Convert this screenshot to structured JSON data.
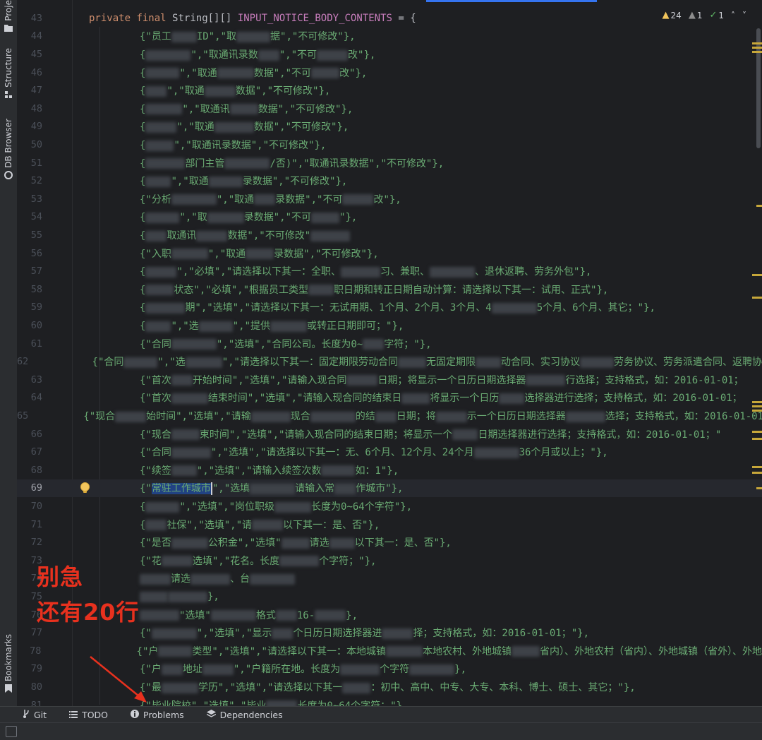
{
  "left_toolbar": {
    "tabs": [
      {
        "label": "Proje",
        "icon": "folder-icon"
      },
      {
        "label": "Structure",
        "icon": "structure-icon"
      },
      {
        "label": "DB Browser",
        "icon": "database-icon"
      },
      {
        "label": "Bookmarks",
        "icon": "bookmark-icon"
      }
    ]
  },
  "inspections": {
    "warnings": "24",
    "weak_warnings": "1",
    "typos": "1",
    "up_arrow": "˄",
    "down_arrow": "˅"
  },
  "editor": {
    "current_line": "69",
    "lines": [
      {
        "n": "43",
        "declaration": {
          "kw1": "private",
          "kw2": "final",
          "type": "String[][]",
          "name": "INPUT_NOTICE_BODY_CONTENTS",
          "rest": " = {"
        }
      },
      {
        "n": "44",
        "parts": [
          "{\"员工",
          "█",
          "ID\",\"取",
          "█",
          "据\",\"不可修改\"},"
        ]
      },
      {
        "n": "45",
        "parts": [
          "{",
          "█",
          "\",\"取通讯录数",
          "█",
          "\",\"不可",
          "█",
          "改\"},"
        ]
      },
      {
        "n": "46",
        "parts": [
          "{",
          "█",
          "\",\"取通",
          "█",
          "数据\",\"不可",
          "█",
          "改\"},"
        ]
      },
      {
        "n": "47",
        "parts": [
          "{",
          "█",
          "\",\"取通",
          "█",
          "数据\",\"不可修改\"},"
        ]
      },
      {
        "n": "48",
        "parts": [
          "{",
          "█",
          "\",\"取通讯",
          "█",
          "数据\",\"不可修改\"},"
        ]
      },
      {
        "n": "49",
        "parts": [
          "{",
          "█",
          "\",\"取通",
          "█",
          "数据\",\"不可修改\"},"
        ]
      },
      {
        "n": "50",
        "parts": [
          "{",
          "█",
          "\",\"取通讯录数据\",\"不可修改\"},"
        ]
      },
      {
        "n": "51",
        "parts": [
          "{",
          "█",
          "部门主管",
          "█",
          "/否)\",\"取通讯录数据\",\"不可修改\"},"
        ]
      },
      {
        "n": "52",
        "parts": [
          "{",
          "█",
          "\",\"取通",
          "█",
          "录数据\",\"不可修改\"},"
        ]
      },
      {
        "n": "53",
        "parts": [
          "{\"分析",
          "█",
          "\",\"取通",
          "█",
          "录数据\",\"不可",
          "█",
          "改\"},"
        ]
      },
      {
        "n": "54",
        "parts": [
          "{",
          "█",
          "\",\"取",
          "█",
          "录数据\",\"不可",
          "█",
          "\"},"
        ]
      },
      {
        "n": "55",
        "parts": [
          "{",
          "█",
          "取通讯",
          "█",
          "数据\",\"不可修改\"",
          "█"
        ]
      },
      {
        "n": "56",
        "parts": [
          "{\"入职",
          "█",
          "\",\"取通",
          "█",
          "录数据\",\"不可修改\"},"
        ]
      },
      {
        "n": "57",
        "parts": [
          "{",
          "█",
          "\",\"必填\",\"请选择以下其一：全职、",
          "█",
          "习、兼职、",
          "█",
          "、退休返聘、劳务外包\"},"
        ]
      },
      {
        "n": "58",
        "parts": [
          "{",
          "█",
          "状态\",\"必填\",\"根据员工类型",
          "█",
          "职日期和转正日期自动计算：请选择以下其一：试用、正式\"},"
        ]
      },
      {
        "n": "59",
        "parts": [
          "{",
          "█",
          "期\",\"选填\",\"请选择以下其一：无试用期、1个月、2个月、3个月、4",
          "█",
          "5个月、6个月、其它；\"},"
        ]
      },
      {
        "n": "60",
        "parts": [
          "{",
          "█",
          "\",\"选",
          "█",
          "\",\"提供",
          "█",
          "或转正日期即可；\"},"
        ]
      },
      {
        "n": "61",
        "parts": [
          "{\"合同",
          "█",
          "\",\"选填\",\"合同公司。长度为0~",
          "█",
          "字符；\"},"
        ]
      },
      {
        "n": "62",
        "parts": [
          "{\"合同",
          "█",
          "\",\"选",
          "█",
          "\",\"请选择以下其一：固定期限劳动合同",
          "█",
          "无固定期限",
          "█",
          "动合同、实习协议",
          "█",
          "劳务协议、劳务派遣合同、返聘协"
        ]
      },
      {
        "n": "63",
        "parts": [
          "{\"首次",
          "█",
          "开始时间\",\"选填\",\"请输入现合同",
          "█",
          "日期；将显示一个日历日期选择器",
          "█",
          "行选择；支持格式，如：2016-01-01；"
        ]
      },
      {
        "n": "64",
        "parts": [
          "{\"首次",
          "█",
          "结束时间\",\"选填\",\"请输入现合同的结束日",
          "█",
          "将显示一个日历",
          "█",
          "选择器进行选择；支持格式，如：2016-01-01；"
        ]
      },
      {
        "n": "65",
        "parts": [
          "{\"现合",
          "█",
          "始时间\",\"选填\",\"请输",
          "█",
          "现合",
          "█",
          "的结",
          "█",
          "日期；将",
          "█",
          "示一个日历日期选择器",
          "█",
          "选择；支持格式，如：2016-01-01；\""
        ]
      },
      {
        "n": "66",
        "parts": [
          "{\"现合",
          "█",
          "束时间\",\"选填\",\"请输入现合同的结束日期；将显示一个",
          "█",
          "日期选择器进行选择；支持格式，如：2016-01-01；\""
        ]
      },
      {
        "n": "67",
        "parts": [
          "{\"合同",
          "█",
          "\",\"选填\",\"请选择以下其一：无、6个月、12个月、24个月",
          "█",
          "36个月或以上；\"},"
        ]
      },
      {
        "n": "68",
        "parts": [
          "{\"续签",
          "█",
          "\",\"选填\",\"请输入续签次数",
          "█",
          "如：1\"},"
        ]
      },
      {
        "n": "69",
        "selected_prefix": "{\"",
        "selected": "常驻工作城市",
        "parts": [
          "\",\"选填",
          "█",
          "请输入常",
          "█",
          "作城市\"},"
        ]
      },
      {
        "n": "70",
        "parts": [
          "{",
          "█",
          "\",\"选填\",\"岗位职级",
          "█",
          "长度为0~64个字符\"},"
        ]
      },
      {
        "n": "71",
        "parts": [
          "{",
          "█",
          "社保\",\"选填\",\"请",
          "█",
          "以下其一：是、否\"},"
        ]
      },
      {
        "n": "72",
        "parts": [
          "{\"是否",
          "█",
          "公积金\",\"选填\"",
          "█",
          "请选",
          "█",
          "以下其一：是、否\"},"
        ]
      },
      {
        "n": "73",
        "parts": [
          "{\"花",
          "█",
          "选填\",\"花名。长度",
          "█",
          "个字符；\"},"
        ]
      },
      {
        "n": "74",
        "parts": [
          "█",
          "请选",
          "█",
          "、台",
          "█"
        ]
      },
      {
        "n": "75",
        "parts": [
          "█",
          "█",
          "},"
        ]
      },
      {
        "n": "76",
        "parts": [
          "█",
          "\"选填\"",
          "█",
          "格式",
          "█",
          "16-",
          "█",
          "},"
        ]
      },
      {
        "n": "77",
        "parts": [
          "{\"",
          "█",
          "\",\"选填\",\"显示",
          "█",
          "个日历日期选择器进",
          "█",
          "择；支持格式，如：2016-01-01；\"},"
        ]
      },
      {
        "n": "78",
        "parts": [
          "{\"户",
          "█",
          "类型\",\"选填\",\"请选择以下其一：本地城镇",
          "█",
          "本地农村、外地城镇",
          "█",
          "省内）、外地农村（省内）、外地城镇（省外）、外地"
        ]
      },
      {
        "n": "79",
        "parts": [
          "{\"户",
          "█",
          "地址",
          "█",
          "\",\"户籍所在地。长度为",
          "█",
          "个字符",
          "█",
          "},"
        ]
      },
      {
        "n": "80",
        "parts": [
          "{\"最",
          "█",
          "学历\",\"选填\",\"请选择以下其一",
          "█",
          "：初中、高中、中专、大专、本科、博士、硕士、其它；\"},"
        ]
      },
      {
        "n": "81",
        "parts": [
          "{\"毕业院校\",\"选填\",\"毕业",
          "█",
          "长度为0~64个字符；\"},"
        ]
      }
    ]
  },
  "annotation": {
    "line1": "别急",
    "line2": "还有20行",
    "color": "#e8311e"
  },
  "bottom_tabs": [
    {
      "label": "Git",
      "icon": "git-branch-icon"
    },
    {
      "label": "TODO",
      "icon": "list-icon"
    },
    {
      "label": "Problems",
      "icon": "info-icon"
    },
    {
      "label": "Dependencies",
      "icon": "layers-icon"
    }
  ]
}
